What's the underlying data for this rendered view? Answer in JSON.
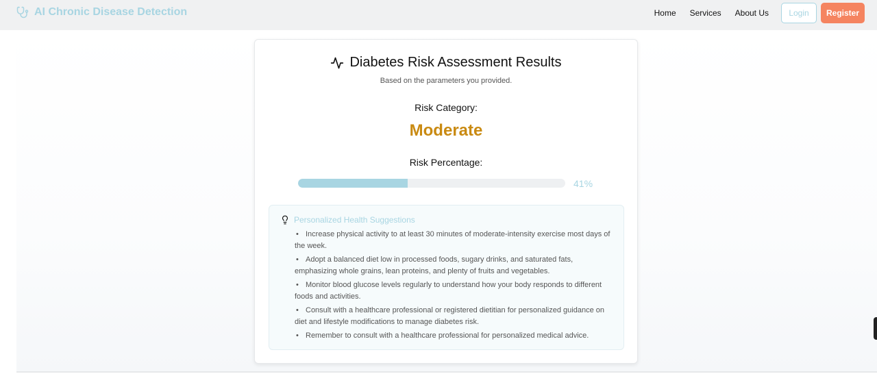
{
  "brand": {
    "name": "AI Chronic Disease Detection",
    "icon": "stethoscope-icon"
  },
  "nav": {
    "links": [
      "Home",
      "Services",
      "About Us"
    ],
    "login_label": "Login",
    "register_label": "Register"
  },
  "result": {
    "title": "Diabetes Risk Assessment Results",
    "title_icon": "activity-icon",
    "subtitle": "Based on the parameters you provided.",
    "risk_category_label": "Risk Category:",
    "risk_category_value": "Moderate",
    "risk_percentage_label": "Risk Percentage:",
    "risk_percentage_value": 41,
    "risk_percentage_text": "41%"
  },
  "suggestions": {
    "icon": "lightbulb-icon",
    "title": "Personalized Health Suggestions",
    "items": [
      "Increase physical activity to at least 30 minutes of moderate-intensity exercise most days of the week.",
      "Adopt a balanced diet low in processed foods, sugary drinks, and saturated fats, emphasizing whole grains, lean proteins, and plenty of fruits and vegetables.",
      "Monitor blood glucose levels regularly to understand how your body responds to different foods and activities.",
      "Consult with a healthcare professional or registered dietitian for personalized guidance on diet and lifestyle modifications to manage diabetes risk.",
      "Remember to consult with a healthcare professional for personalized medical advice."
    ]
  },
  "colors": {
    "brand_accent": "#a8d5e2",
    "register_button": "#f58460",
    "risk_moderate": "#c98a12"
  }
}
